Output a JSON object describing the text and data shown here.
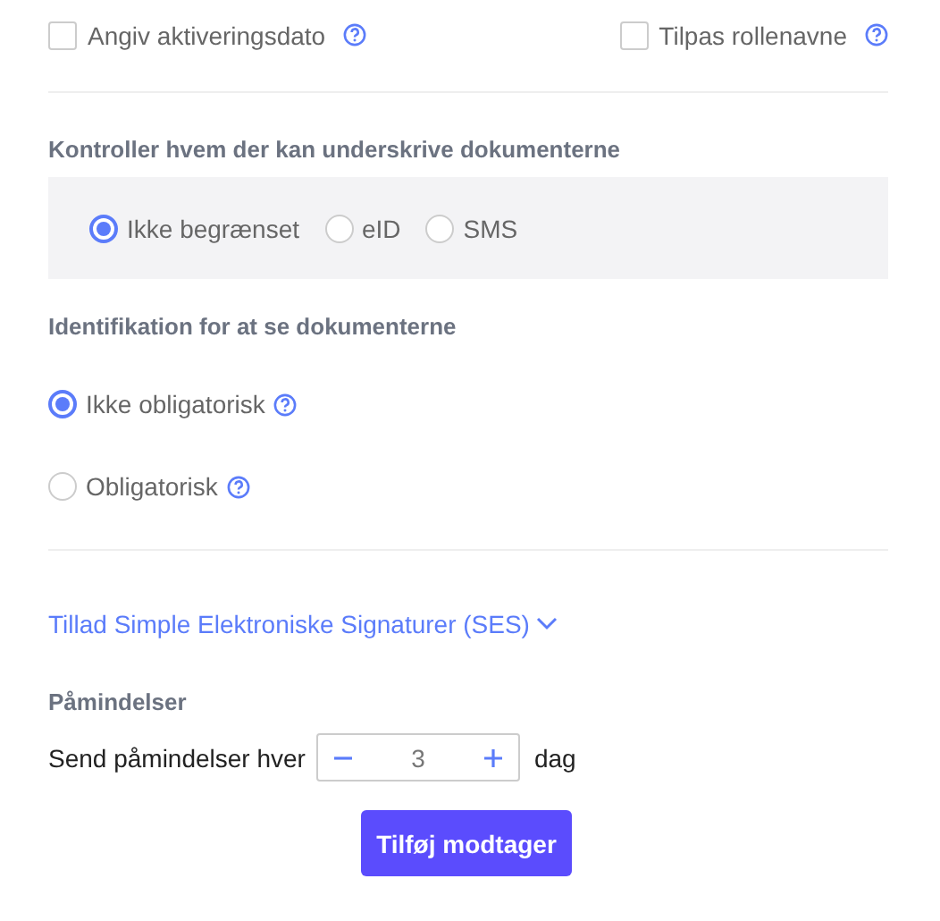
{
  "options": [
    {
      "label": "Angiv aktiveringsdato",
      "checked": false
    },
    {
      "label": "Tilpas rollenavne",
      "checked": false
    }
  ],
  "signing": {
    "heading": "Kontroller hvem der kan underskrive dokumenterne",
    "choices": [
      {
        "label": "Ikke begrænset",
        "selected": true
      },
      {
        "label": "eID",
        "selected": false
      },
      {
        "label": "SMS",
        "selected": false
      }
    ]
  },
  "identification": {
    "heading": "Identifikation for at se dokumenterne",
    "choices": [
      {
        "label": "Ikke obligatorisk",
        "selected": true
      },
      {
        "label": "Obligatorisk",
        "selected": false
      }
    ]
  },
  "ses_link": {
    "label": "Tillad Simple Elektroniske Signaturer (SES)",
    "expanded": false
  },
  "reminders": {
    "heading": "Påmindelser",
    "prefix": "Send påmindelser hver",
    "value": "3",
    "suffix": "dag"
  },
  "button": "Tilføj modtager"
}
